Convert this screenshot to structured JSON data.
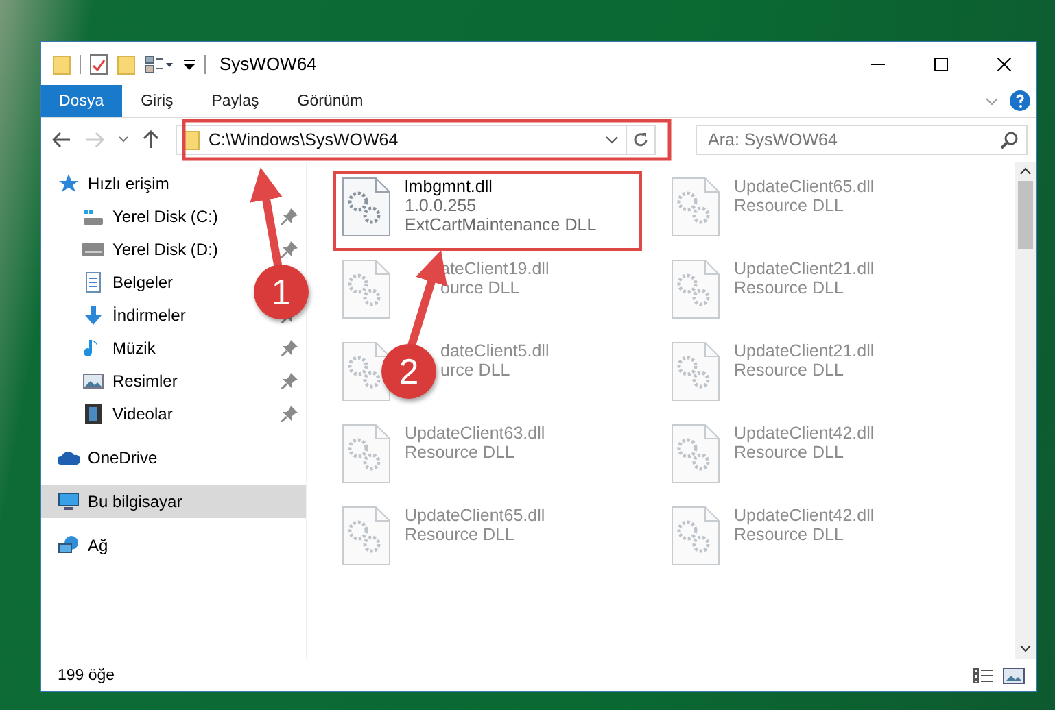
{
  "window": {
    "title": "SysWOW64"
  },
  "ribbon": {
    "tabs": [
      {
        "label": "Dosya",
        "kind": "file",
        "selected": false
      },
      {
        "label": "Giriş",
        "kind": "tab",
        "selected": false
      },
      {
        "label": "Paylaş",
        "kind": "tab",
        "selected": false
      },
      {
        "label": "Görünüm",
        "kind": "tab",
        "selected": false
      }
    ]
  },
  "address_bar": {
    "path": "C:\\Windows\\SysWOW64"
  },
  "search": {
    "placeholder": "Ara: SysWOW64"
  },
  "navigation": [
    {
      "label": "Hızlı erişim",
      "kind": "star",
      "selected": false,
      "children": [
        {
          "label": "Yerel Disk (C:)",
          "kind": "sysdrive",
          "pinned": true,
          "selected": false
        },
        {
          "label": "Yerel Disk (D:)",
          "kind": "drive",
          "pinned": true,
          "selected": false
        },
        {
          "label": "Belgeler",
          "kind": "docs",
          "selected": false
        },
        {
          "label": "İndirmeler",
          "kind": "download",
          "pinned": true,
          "selected": false
        },
        {
          "label": "Müzik",
          "kind": "music",
          "pinned": true,
          "selected": false
        },
        {
          "label": "Resimler",
          "kind": "pictures",
          "pinned": true,
          "selected": false
        },
        {
          "label": "Videolar",
          "kind": "videos",
          "pinned": true,
          "selected": false
        }
      ]
    },
    {
      "label": "OneDrive",
      "kind": "cloud",
      "selected": false
    },
    {
      "label": "Bu bilgisayar",
      "kind": "computer",
      "selected": true
    },
    {
      "label": "Ağ",
      "kind": "network",
      "selected": false
    }
  ],
  "files": [
    {
      "name": "lmbgmnt.dll",
      "details": [
        "1.0.0.255",
        "ExtCartMaintenance DLL"
      ],
      "faded": false,
      "highlighted": true,
      "partly_covered": false
    },
    {
      "name": "UpdateClient65.dll",
      "details": [
        "Resource DLL"
      ],
      "faded": true,
      "highlighted": false,
      "partly_covered": false
    },
    {
      "name": "ateClient19.dll",
      "details": [
        "ource DLL"
      ],
      "faded": true,
      "highlighted": false,
      "partly_covered": true
    },
    {
      "name": "UpdateClient21.dll",
      "details": [
        "Resource DLL"
      ],
      "faded": true,
      "highlighted": false,
      "partly_covered": false
    },
    {
      "name": "dateClient5.dll",
      "details": [
        "urce DLL"
      ],
      "faded": true,
      "highlighted": false,
      "partly_covered": true
    },
    {
      "name": "UpdateClient21.dll",
      "details": [
        "Resource DLL"
      ],
      "faded": true,
      "highlighted": false,
      "partly_covered": false
    },
    {
      "name": "UpdateClient63.dll",
      "details": [
        "Resource DLL"
      ],
      "faded": true,
      "highlighted": false,
      "partly_covered": false
    },
    {
      "name": "UpdateClient42.dll",
      "details": [
        "Resource DLL"
      ],
      "faded": true,
      "highlighted": false,
      "partly_covered": false
    },
    {
      "name": "UpdateClient65.dll",
      "details": [
        "Resource DLL"
      ],
      "faded": true,
      "highlighted": false,
      "partly_covered": false
    },
    {
      "name": "UpdateClient42.dll",
      "details": [
        "Resource DLL"
      ],
      "faded": true,
      "highlighted": false,
      "partly_covered": false
    }
  ],
  "annotations": [
    {
      "label": "1"
    },
    {
      "label": "2"
    }
  ],
  "status_bar": {
    "count": "199 öğe"
  }
}
